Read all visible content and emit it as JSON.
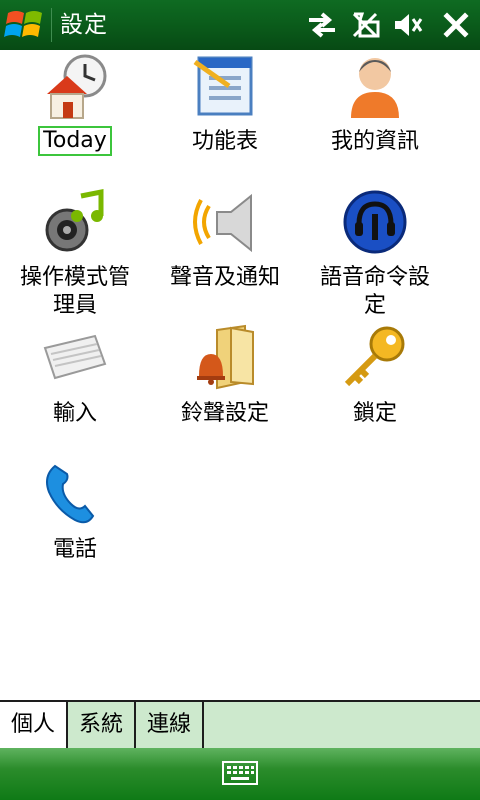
{
  "window": {
    "title": "設定"
  },
  "items": [
    {
      "label": "Today",
      "icon": "today-house-clock-icon"
    },
    {
      "label": "功能表",
      "icon": "menu-document-icon"
    },
    {
      "label": "我的資訊",
      "icon": "owner-person-icon"
    },
    {
      "label": "操作模式管理員",
      "icon": "profile-speaker-music-icon"
    },
    {
      "label": "聲音及通知",
      "icon": "sound-speaker-icon"
    },
    {
      "label": "語音命令設定",
      "icon": "voice-command-headset-icon"
    },
    {
      "label": "輸入",
      "icon": "keyboard-icon"
    },
    {
      "label": "鈴聲設定",
      "icon": "ringtone-bell-folder-icon"
    },
    {
      "label": "鎖定",
      "icon": "lock-key-icon"
    },
    {
      "label": "電話",
      "icon": "phone-handset-icon"
    }
  ],
  "tabs": [
    {
      "label": "個人",
      "active": true
    },
    {
      "label": "系統",
      "active": false
    },
    {
      "label": "連線",
      "active": false
    }
  ],
  "colors": {
    "titlebar": "#0a5a1a",
    "selection_border": "#3cc53c",
    "tab_background": "#cde9cd",
    "softbar": "#1a8a1a"
  }
}
